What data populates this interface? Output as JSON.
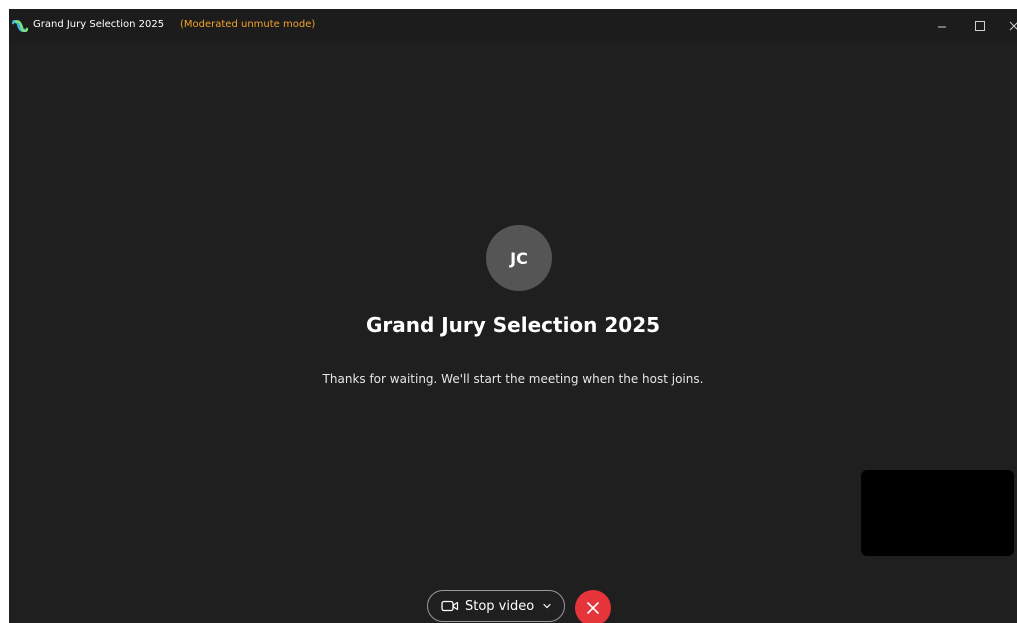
{
  "titlebar": {
    "title": "Grand Jury Selection 2025",
    "mode": "(Moderated unmute mode)",
    "logo_icon": "webex-logo-icon",
    "controls": [
      "minimize-icon",
      "maximize-icon",
      "close-icon"
    ]
  },
  "meeting": {
    "avatar_initials": "JC",
    "title": "Grand Jury Selection 2025",
    "message": "Thanks for waiting. We'll start the meeting when the host joins."
  },
  "controls": {
    "stop_video_label": "Stop video",
    "video_icon": "video-camera-icon",
    "dropdown_icon": "chevron-down-icon",
    "leave_icon": "close-icon"
  },
  "colors": {
    "background": "#1e1e1e",
    "mode_text": "#f2a12b",
    "avatar": "#555555",
    "leave_button": "#e5343a"
  }
}
